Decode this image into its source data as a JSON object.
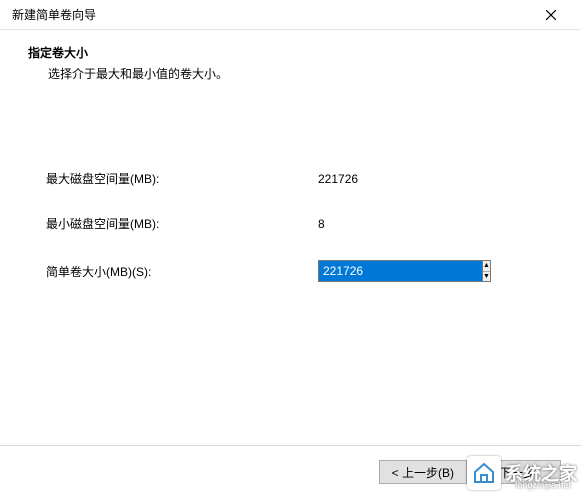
{
  "window": {
    "title": "新建简单卷向导"
  },
  "header": {
    "title": "指定卷大小",
    "subtitle": "选择介于最大和最小值的卷大小。"
  },
  "fields": {
    "max": {
      "label": "最大磁盘空间量(MB):",
      "value": "221726"
    },
    "min": {
      "label": "最小磁盘空间量(MB):",
      "value": "8"
    },
    "size": {
      "label": "简单卷大小(MB)(S):",
      "value": "221726"
    }
  },
  "buttons": {
    "back": "< 上一步(B)",
    "next": "下一步"
  },
  "watermark": {
    "text": "系统之家",
    "sub": "tongzhujia.net"
  }
}
